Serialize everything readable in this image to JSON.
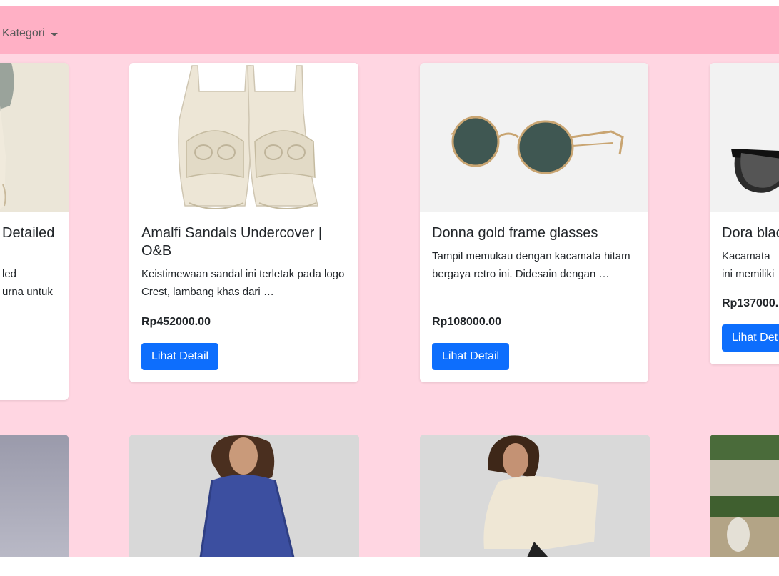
{
  "navbar": {
    "dropdown_label": "Kategori"
  },
  "products": [
    {
      "title_partial": "Detailed",
      "desc_line1": "led",
      "desc_line2": "urna untuk"
    },
    {
      "title": "Amalfi Sandals Undercover | O&B",
      "desc": "Keistimewaan sandal ini terletak pada logo Crest, lambang khas dari …",
      "price": "Rp452000.00",
      "button": "Lihat Detail"
    },
    {
      "title": "Donna gold frame glasses",
      "desc": "Tampil memukau dengan kacamata hitam bergaya retro ini. Didesain dengan …",
      "price": "Rp108000.00",
      "button": "Lihat Detail"
    },
    {
      "title": "Dora blac",
      "desc_line1": "Kacamata",
      "desc_line2": "ini memiliki",
      "price": "Rp137000.",
      "button": "Lihat Det"
    }
  ],
  "colors": {
    "navbar": "#ffb0c5",
    "page": "#ffd6e2",
    "button": "#0d6efd"
  }
}
